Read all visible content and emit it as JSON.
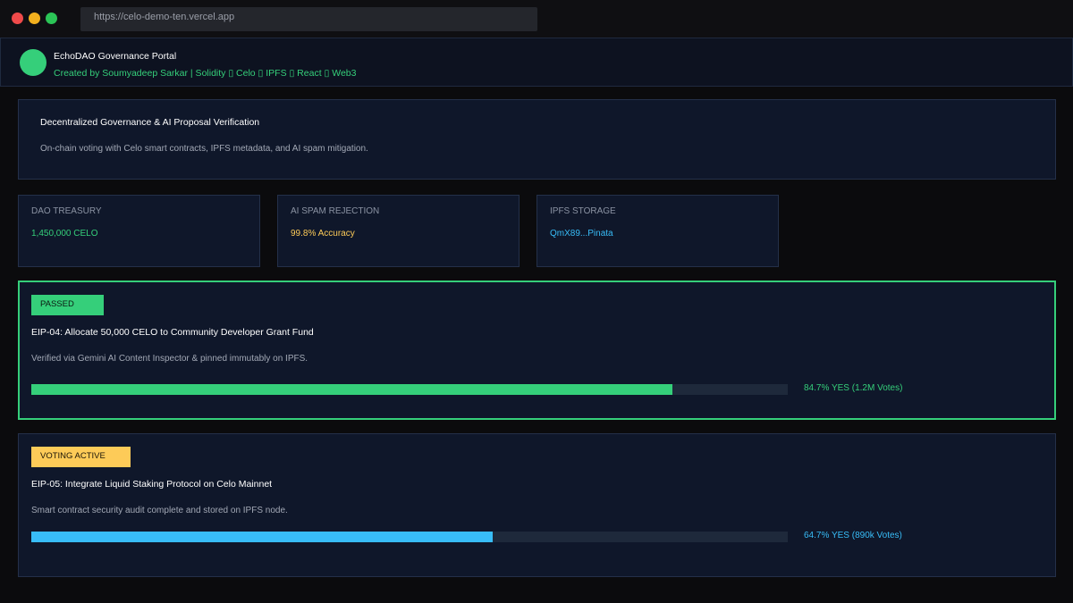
{
  "browser": {
    "url": "https://celo-demo-ten.vercel.app"
  },
  "header": {
    "title": "EchoDAO Governance Portal",
    "subtitle": "Created by Soumyadeep Sarkar | Solidity ▯ Celo ▯ IPFS ▯ React ▯ Web3"
  },
  "hero": {
    "title": "Decentralized Governance & AI Proposal Verification",
    "description": "On-chain voting with Celo smart contracts, IPFS metadata, and AI spam mitigation."
  },
  "stats": [
    {
      "label": "DAO TREASURY",
      "value": "1,450,000 CELO",
      "color": "#35cf7a"
    },
    {
      "label": "AI SPAM REJECTION",
      "value": "99.8% Accuracy",
      "color": "#fdcb58"
    },
    {
      "label": "IPFS STORAGE",
      "value": "QmX89...Pinata",
      "color": "#38bdf8"
    }
  ],
  "proposals": [
    {
      "status": "PASSED",
      "title": "EIP-04: Allocate 50,000 CELO to Community Developer Grant Fund",
      "description": "Verified via Gemini AI Content Inspector & pinned immutably on IPFS.",
      "yes_percent": 84.7,
      "vote_text": "84.7% YES (1.2M Votes)",
      "color": "#35cf7a"
    },
    {
      "status": "VOTING ACTIVE",
      "title": "EIP-05: Integrate Liquid Staking Protocol on Celo Mainnet",
      "description": "Smart contract security audit complete and stored on IPFS node.",
      "yes_percent": 61,
      "vote_text": "64.7% YES (890k Votes)",
      "color": "#38bdf8"
    }
  ]
}
